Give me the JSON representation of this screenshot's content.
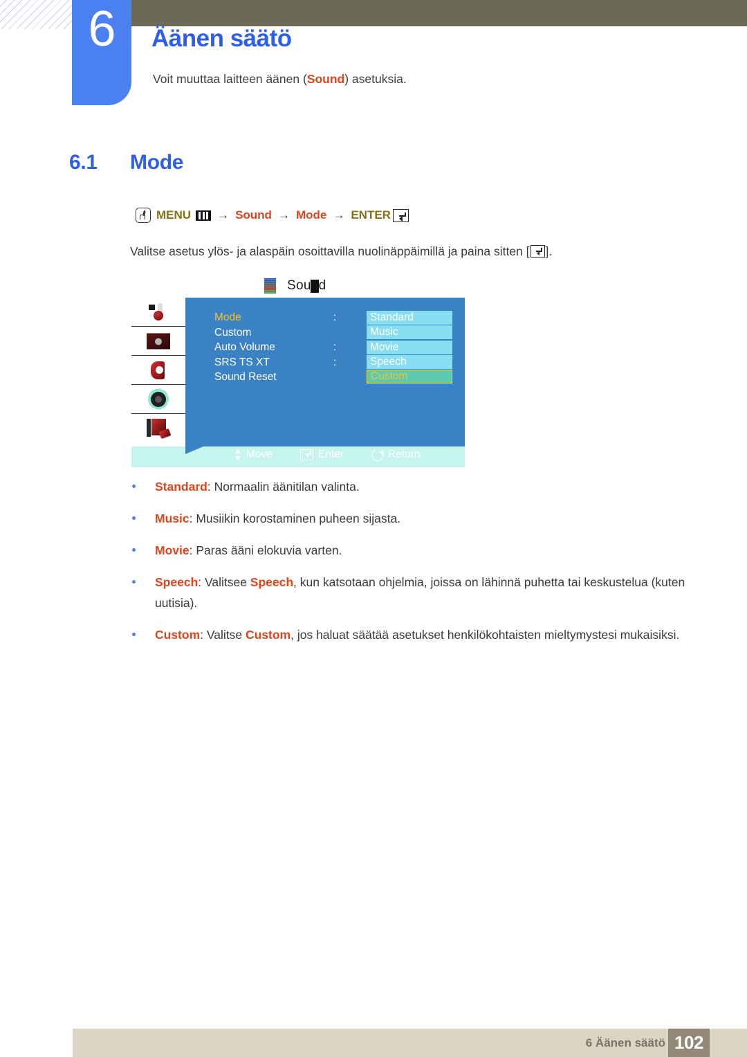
{
  "header": {
    "chapter_number": "6",
    "chapter_title": "Äänen säätö",
    "chapter_desc_before": "Voit muuttaa laitteen äänen (",
    "chapter_desc_keyword": "Sound",
    "chapter_desc_after": ") asetuksia."
  },
  "section": {
    "number": "6.1",
    "title": "Mode"
  },
  "nav_path": {
    "menu_label": "MENU",
    "arrow": "→",
    "item1": "Sound",
    "item2": "Mode",
    "enter_label": "ENTER",
    "button_icon": "hand-press-button-icon",
    "menu_icon": "menu-bars-icon",
    "enter_icon": "enter-return-icon"
  },
  "paragraph": {
    "before": "Valitse asetus ylös- ja alaspäin osoittavilla nuolinäppäimillä ja paina sitten [",
    "after": "]."
  },
  "osd": {
    "title": "Sound",
    "title_icon": "sound-category-icon",
    "side_icons": [
      "picture-icon",
      "screen-icon",
      "sound-icon",
      "setup-gear-icon",
      "support-book-icon"
    ],
    "rows": [
      {
        "label": "Mode",
        "colon": ":",
        "active": true
      },
      {
        "label": "Custom",
        "colon": "",
        "active": false
      },
      {
        "label": "Auto Volume",
        "colon": ":",
        "active": false
      },
      {
        "label": "SRS TS XT",
        "colon": ":",
        "active": false
      },
      {
        "label": "Sound Reset",
        "colon": "",
        "active": false
      }
    ],
    "values": [
      {
        "label": "Standard",
        "selected": false
      },
      {
        "label": "Music",
        "selected": false
      },
      {
        "label": "Movie",
        "selected": false
      },
      {
        "label": "Speech",
        "selected": false
      },
      {
        "label": "Custom",
        "selected": true
      }
    ],
    "footbar": [
      {
        "label": "Move",
        "icon": "up-down-arrows-icon"
      },
      {
        "label": "Enter",
        "icon": "enter-key-icon"
      },
      {
        "label": "Return",
        "icon": "return-arrow-icon"
      }
    ]
  },
  "bullets": [
    {
      "term": "Standard",
      "rest": ": Normaalin äänitilan valinta."
    },
    {
      "term": "Music",
      "rest": ": Musiikin korostaminen puheen sijasta."
    },
    {
      "term": "Movie",
      "rest": ": Paras ääni elokuvia varten."
    },
    {
      "term": "Speech",
      "mid_before": ": Valitsee ",
      "mid_term": "Speech",
      "rest": ", kun katsotaan ohjelmia, joissa on lähinnä puhetta tai keskustelua (kuten uutisia)."
    },
    {
      "term": "Custom",
      "mid_before": ": Valitse ",
      "mid_term": "Custom",
      "rest": ", jos haluat säätää asetukset henkilökohtaisten mieltymystesi mukaisiksi."
    }
  ],
  "footer": {
    "label": "6 Äänen säätö",
    "page": "102"
  },
  "colors": {
    "brand_blue": "#4a80ef",
    "heading_blue": "#2e5fe8",
    "keyword_red": "#e0451c",
    "keyword_olive": "#857215",
    "olive_bar": "#6c6a56",
    "osd_panel": "#3b82c4",
    "osd_value": "#88dff0",
    "osd_selected": "#5ccaae",
    "osd_highlight_text": "#f2c230",
    "footer_bar": "#dbd6c3",
    "footer_page": "#938778"
  }
}
